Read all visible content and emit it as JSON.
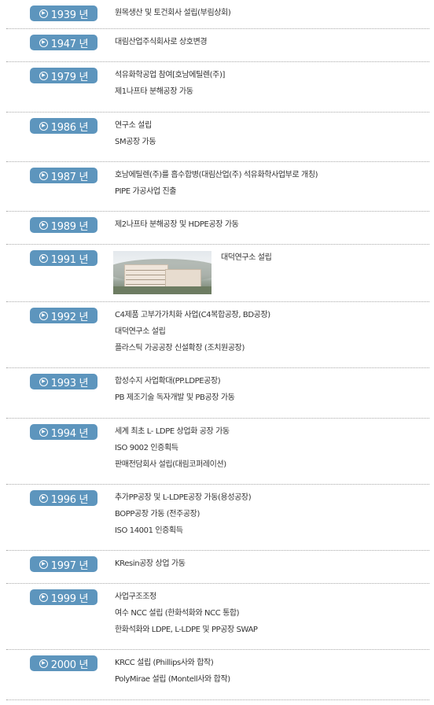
{
  "timeline": [
    {
      "year": "1939 년",
      "events": [
        "원목생산 및 토건회사 설립(부림상회)"
      ]
    },
    {
      "year": "1947 년",
      "events": [
        "대림산업주식회사로 상호변경"
      ]
    },
    {
      "year": "1979 년",
      "events": [
        "석유화학공업 참여[호남에틸렌(주)]",
        "제1나프타 분해공장 가동"
      ]
    },
    {
      "year": "1986 년",
      "events": [
        "연구소 설립",
        "SM공장 가동"
      ]
    },
    {
      "year": "1987 년",
      "events": [
        "호남에틸렌(주)를 흡수합병(대림산업(주) 석유화학사업부로 개칭)",
        "PIPE 가공사업 진출"
      ]
    },
    {
      "year": "1989 년",
      "events": [
        "제2나프타 분해공장 및 HDPE공장 가동"
      ]
    },
    {
      "year": "1991 년",
      "photo_caption": "대덕연구소 설립",
      "events": []
    },
    {
      "year": "1992 년",
      "events": [
        "C4제품 고부가가치화 사업(C4복합공장, BD공장)",
        "대덕연구소 설립",
        "플라스틱 가공공장 신설확장 (조치원공장)"
      ]
    },
    {
      "year": "1993 년",
      "events": [
        "합성수지 사업확대(PP.LDPE공장)",
        "PB 제조기술 독자개발 및 PB공장 가동"
      ]
    },
    {
      "year": "1994 년",
      "events": [
        "세계 최초 L- LDPE 상업화 공장 가동",
        "ISO 9002 인증획득",
        "판매전담회사 설립(대림코퍼레이션)"
      ]
    },
    {
      "year": "1996 년",
      "events": [
        "추가PP공장 및 L-LDPE공장 가동(용성공장)",
        "BOPP공장 가동 (전주공장)",
        "ISO 14001 인증획득"
      ]
    },
    {
      "year": "1997 년",
      "events": [
        "KResin공장 상업 가동"
      ]
    },
    {
      "year": "1999 년",
      "events": [
        "사업구조조정",
        "여수 NCC 설립 (한화석화와 NCC 통합)",
        "한화석화와 LDPE, L-LDPE 및 PP공장 SWAP"
      ]
    },
    {
      "year": "2000 년",
      "events": [
        "KRCC 설립 (Phillips사와 합작)",
        "PolyMirae 설립 (Montell사와 합작)"
      ]
    }
  ],
  "badge_icon": "circle-arrow-icon",
  "photo_icon": "research-building-photo",
  "colors": {
    "badge": "#5d95bd",
    "text": "#333333",
    "separator": "#a8a8a8"
  }
}
